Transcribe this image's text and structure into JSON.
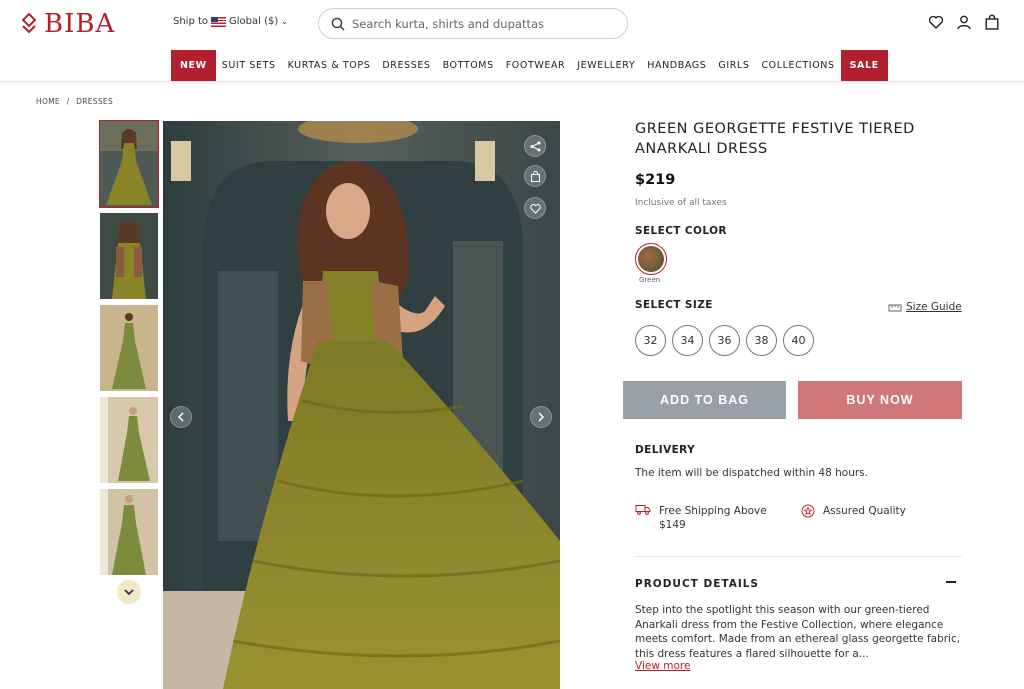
{
  "brand": {
    "name": "BIBA"
  },
  "header": {
    "ship_to_label": "Ship to",
    "region": "Global ($)",
    "search_placeholder": "Search kurta, shirts and dupattas"
  },
  "nav": [
    "NEW",
    "SUIT SETS",
    "KURTAS & TOPS",
    "DRESSES",
    "BOTTOMS",
    "FOOTWEAR",
    "JEWELLERY",
    "HANDBAGS",
    "GIRLS",
    "COLLECTIONS",
    "SALE"
  ],
  "breadcrumb": {
    "home": "HOME",
    "sep": "/",
    "current": "DRESSES"
  },
  "product": {
    "title": "GREEN GEORGETTE FESTIVE TIERED ANARKALI DRESS",
    "price": "$219",
    "tax_note": "Inclusive of all taxes",
    "color_label": "SELECT COLOR",
    "color_name": "Green",
    "size_label": "SELECT SIZE",
    "size_guide": "Size Guide",
    "sizes": [
      "32",
      "34",
      "36",
      "38",
      "40"
    ],
    "add_to_bag": "ADD TO BAG",
    "buy_now": "BUY NOW",
    "delivery_label": "DELIVERY",
    "delivery_text": "The item will be dispatched within 48 hours.",
    "free_shipping_line1": "Free Shipping Above",
    "free_shipping_line2": "$149",
    "assured_quality": "Assured Quality",
    "details_label": "PRODUCT DETAILS",
    "details_text": "Step into the spotlight this season with our green-tiered Anarkali dress from the Festive Collection, where elegance meets comfort. Made from an ethereal glass georgette fabric, this dress features a flared silhouette for a...",
    "view_more": "View more"
  },
  "colors": {
    "brand_red": "#b3202d",
    "add_to_bag_bg": "#9aa0a8",
    "buy_now_bg": "#cf7779",
    "dress_olive": "#8f8a2a"
  }
}
